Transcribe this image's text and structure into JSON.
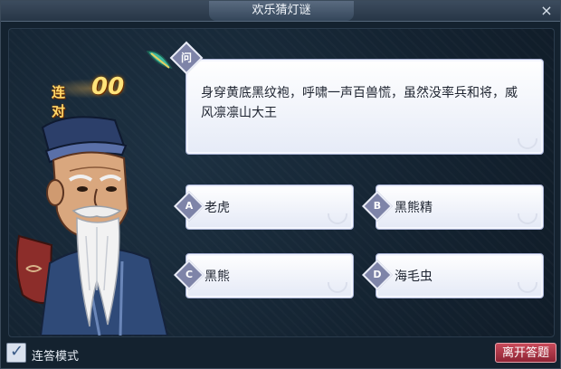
{
  "window": {
    "title": "欢乐猜灯谜",
    "close_glyph": "×"
  },
  "streak": {
    "label": "连对",
    "count": "00"
  },
  "question": {
    "badge": "问",
    "text": "身穿黄底黑纹袍，呼啸一声百兽慌，虽然没率兵和将，威风凛凛山大王"
  },
  "options": [
    {
      "letter": "A",
      "label": "老虎"
    },
    {
      "letter": "B",
      "label": "黑熊精"
    },
    {
      "letter": "C",
      "label": "黑熊"
    },
    {
      "letter": "D",
      "label": "海毛虫"
    }
  ],
  "footer": {
    "continuous_mode_label": "连答模式",
    "continuous_mode_checked": true,
    "leave_label": "离开答题"
  },
  "colors": {
    "accent": "#7e84a8",
    "leave_button": "#a83444",
    "streak_gold": "#ffd86a"
  }
}
